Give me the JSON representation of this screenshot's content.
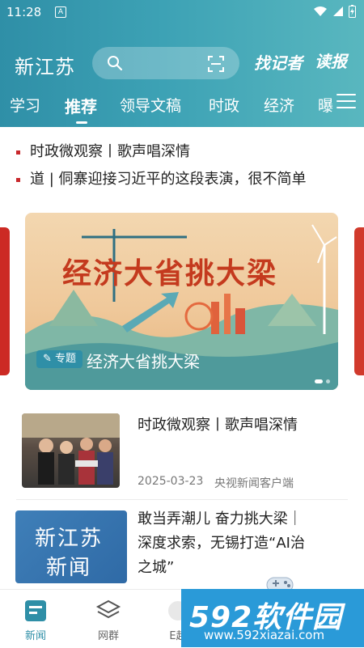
{
  "status_bar": {
    "time": "11:28",
    "notification": "A"
  },
  "header": {
    "brand": "新江苏",
    "find_reporter": "找记者",
    "read_paper": "读报",
    "tabs": [
      {
        "label": "学习"
      },
      {
        "label": "推荐"
      },
      {
        "label": "领导文稿"
      },
      {
        "label": "时政"
      },
      {
        "label": "经济"
      },
      {
        "label": "曝"
      }
    ],
    "active_tab": "推荐"
  },
  "headlines": [
    {
      "text": "时政微观察丨歌声唱深情"
    },
    {
      "text": "道 | 侗寨迎接习近平的这段表演，很不简单"
    }
  ],
  "banner": {
    "art_title": "经济大省挑大梁",
    "badge": "专题",
    "caption": "经济大省挑大梁"
  },
  "news": [
    {
      "title": "时政微观察丨歌声唱深情",
      "date": "2025-03-23",
      "source": "央视新闻客户端"
    },
    {
      "title_lines": [
        "敢当弄潮儿 奋力挑大梁｜",
        "深度求索，无锡打造“AI治",
        "之城”"
      ],
      "thumb_text_1": "新江苏",
      "thumb_text_2": "新闻"
    }
  ],
  "tabbar": {
    "items": [
      {
        "label": "新闻"
      },
      {
        "label": "网群"
      },
      {
        "label": "E起"
      }
    ],
    "active": "新闻"
  },
  "watermark": {
    "logo": "592软件园",
    "url": "www.592xiazai.com"
  },
  "colors": {
    "brand": "#2f8fa7",
    "accent_red": "#c8282c"
  }
}
